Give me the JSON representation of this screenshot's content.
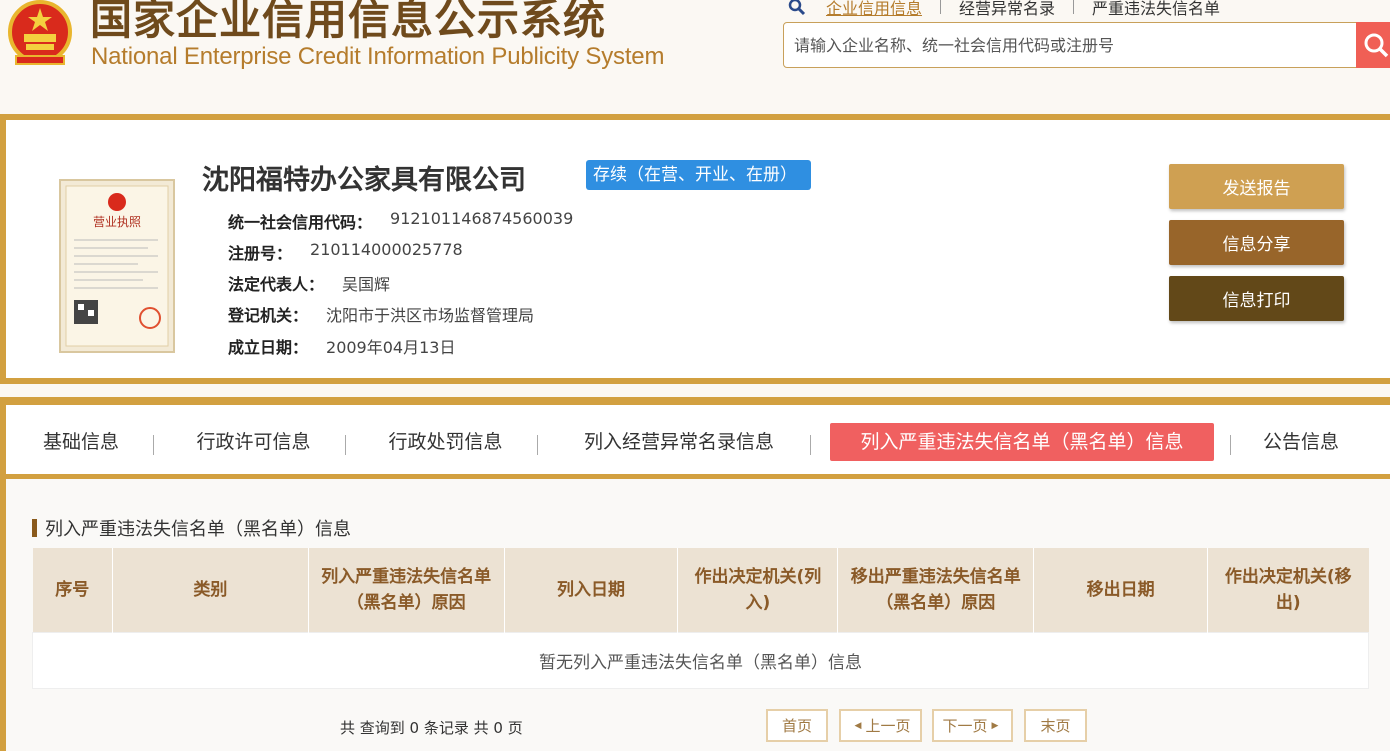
{
  "header": {
    "title_cn": "国家企业信用信息公示系统",
    "title_en": "National Enterprise Credit Information Publicity System",
    "nav": [
      "企业信用信息",
      "经营异常名录",
      "严重违法失信名单"
    ],
    "search_placeholder": "请输入企业名称、统一社会信用代码或注册号"
  },
  "company": {
    "name": "沈阳福特办公家具有限公司",
    "status": "存续（在营、开业、在册）",
    "license_heading": "营业执照",
    "fields": [
      {
        "label": "统一社会信用代码：",
        "value": "912101146874560039"
      },
      {
        "label": "注册号：",
        "value": "210114000025778"
      },
      {
        "label": "法定代表人：",
        "value": "吴国辉"
      },
      {
        "label": "登记机关：",
        "value": "沈阳市于洪区市场监督管理局"
      },
      {
        "label": "成立日期：",
        "value": "2009年04月13日"
      }
    ],
    "actions": [
      "发送报告",
      "信息分享",
      "信息打印"
    ]
  },
  "tabs": [
    "基础信息",
    "行政许可信息",
    "行政处罚信息",
    "列入经营异常名录信息",
    "列入严重违法失信名单（黑名单）信息",
    "公告信息"
  ],
  "active_tab": 4,
  "section": {
    "title": "列入严重违法失信名单（黑名单）信息",
    "columns": [
      "序号",
      "类别",
      "列入严重违法失信名单（黑名单）原因",
      "列入日期",
      "作出决定机关(列入)",
      "移出严重违法失信名单（黑名单）原因",
      "移出日期",
      "作出决定机关(移出)"
    ],
    "empty_message": "暂无列入严重违法失信名单（黑名单）信息"
  },
  "pagination": {
    "summary": "共 查询到 0 条记录 共 0 页",
    "first": "首页",
    "prev": "上一页",
    "next": "下一页",
    "last": "末页"
  },
  "colors": {
    "gold_border": "#d2a040",
    "status_blue": "#2f8fe1",
    "active_tab_red": "#f06060",
    "btn_send": "#cfa052",
    "btn_share": "#98652a",
    "btn_print": "#624818",
    "search_btn": "#f05f55"
  },
  "icons": [
    "national-emblem-icon",
    "search-icon",
    "business-license-image"
  ]
}
